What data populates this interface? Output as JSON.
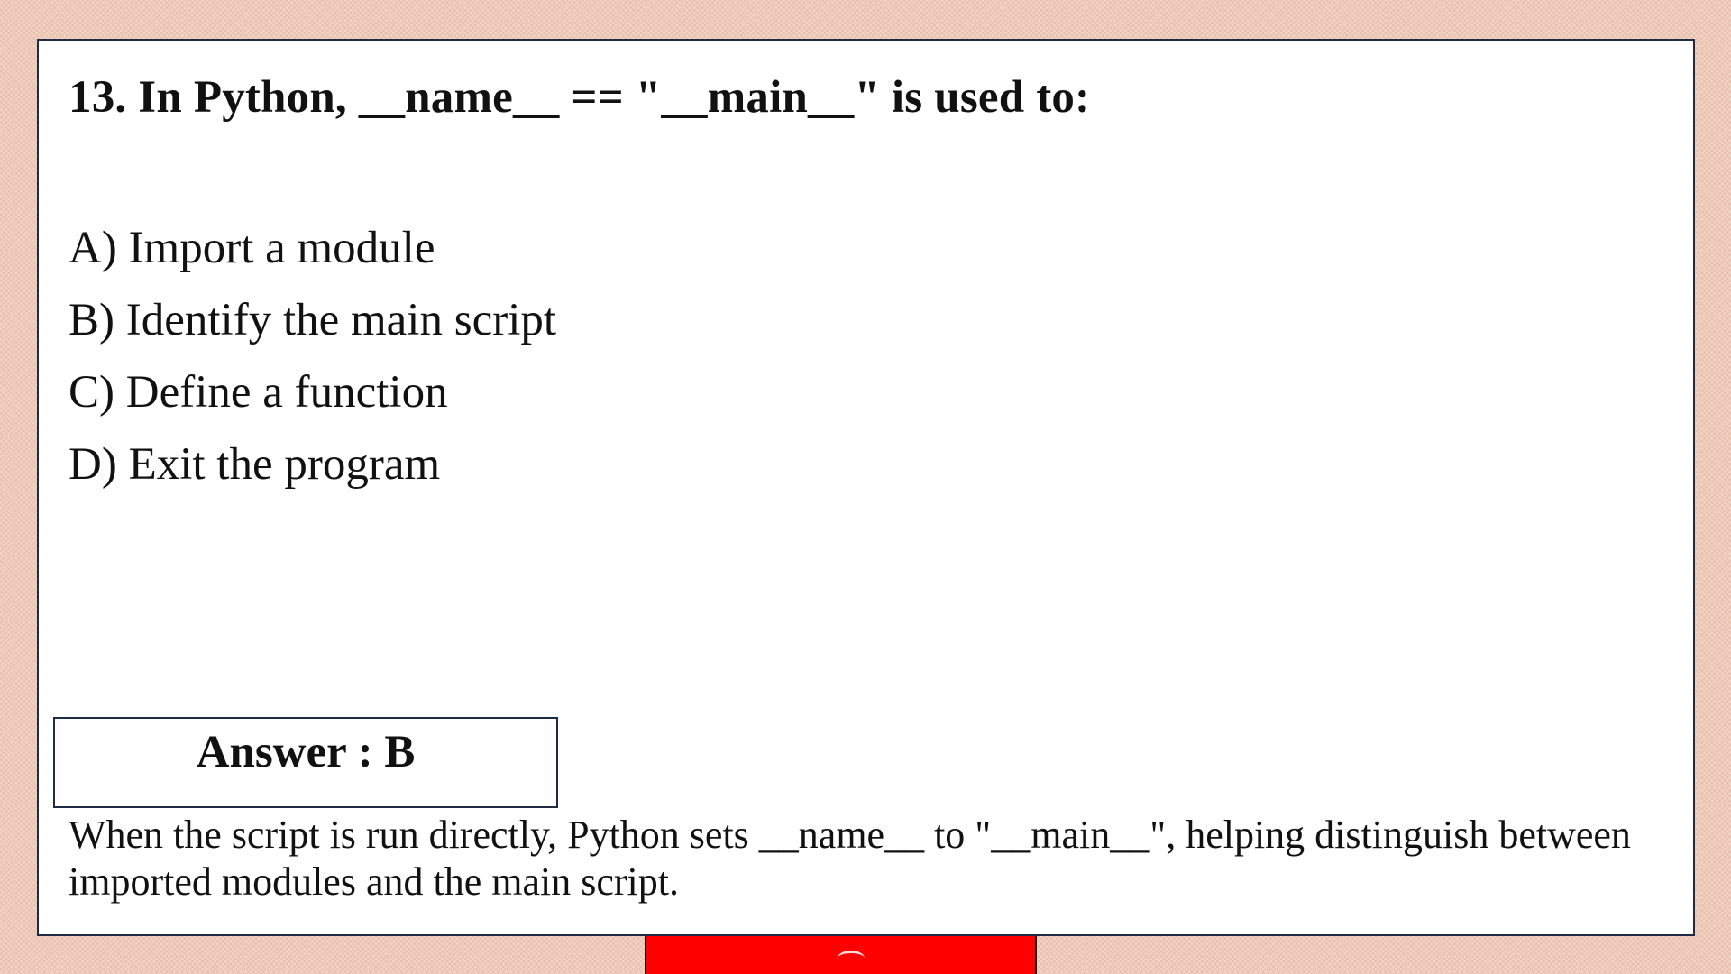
{
  "question": {
    "title": "13. In Python, __name__ == \"__main__\" is used to:"
  },
  "options": [
    {
      "label": "A) Import a module"
    },
    {
      "label": "B) Identify the main script"
    },
    {
      "label": "C) Define a function"
    },
    {
      "label": "D) Exit the program"
    }
  ],
  "answer": {
    "label": "Answer : B"
  },
  "explanation": {
    "text": "When the script is run directly, Python sets __name__ to \"__main__\", helping distinguish between imported modules and the main script."
  },
  "colors": {
    "background": "#f3d2c2",
    "card": "#ffffff",
    "border": "#1f2a44",
    "bottom_tab": "#ff0000"
  }
}
